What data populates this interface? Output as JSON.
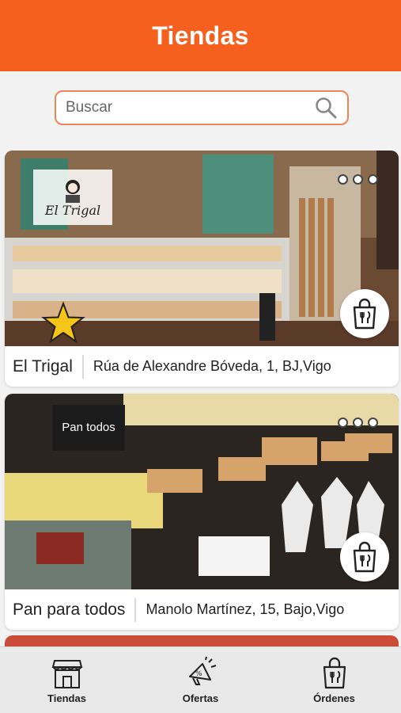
{
  "header": {
    "title": "Tiendas"
  },
  "search": {
    "placeholder": "Buscar",
    "value": ""
  },
  "stores": [
    {
      "name": "El Trigal",
      "address": "Rúa de Alexandre Bóveda, 1, BJ,Vigo",
      "logo_text": "El Trigal",
      "featured": true
    },
    {
      "name": "Pan para todos",
      "address": "Manolo Martínez, 15, Bajo,Vigo",
      "logo_text": "Pan todos",
      "featured": false
    }
  ],
  "colors": {
    "brand": "#f6601e",
    "search_border": "#f0845a",
    "star": "#f5c518"
  },
  "icons": {
    "store": "store-icon",
    "offers": "discount-megaphone-icon",
    "orders": "shopping-bag-icon",
    "search": "search-icon",
    "more": "more-dots-icon"
  },
  "bottom_nav": [
    {
      "label": "Tiendas"
    },
    {
      "label": "Ofertas"
    },
    {
      "label": "Órdenes"
    }
  ]
}
